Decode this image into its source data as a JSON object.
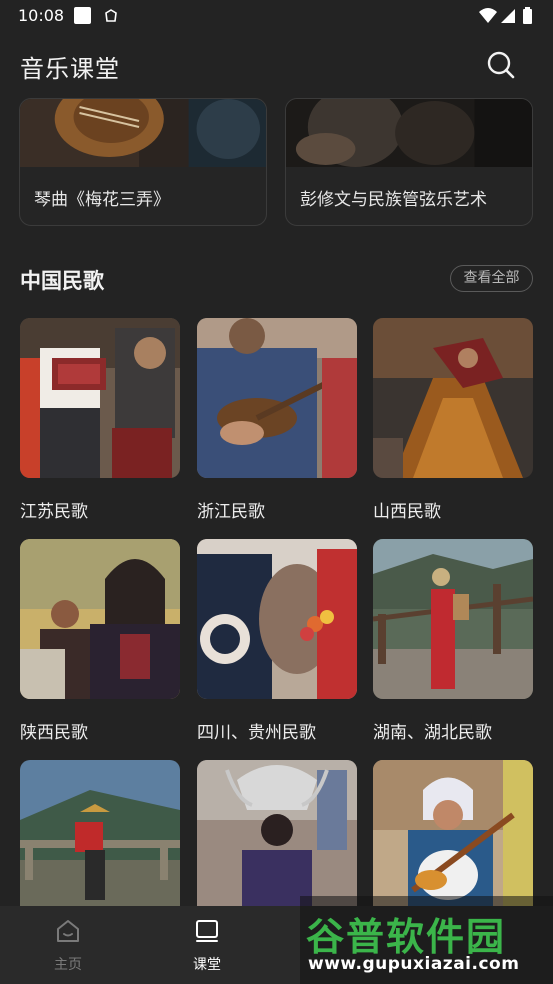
{
  "status_bar": {
    "time": "10:08"
  },
  "app_bar": {
    "title": "音乐课堂"
  },
  "top_cards": [
    {
      "label": "琴曲《梅花三弄》"
    },
    {
      "label": "彭修文与民族管弦乐艺术"
    }
  ],
  "section": {
    "title": "中国民歌",
    "view_all": "查看全部"
  },
  "folk_songs": [
    {
      "label": "江苏民歌"
    },
    {
      "label": "浙江民歌"
    },
    {
      "label": "山西民歌"
    },
    {
      "label": "陕西民歌"
    },
    {
      "label": "四川、贵州民歌"
    },
    {
      "label": "湖南、湖北民歌"
    },
    {
      "label": ""
    },
    {
      "label": ""
    },
    {
      "label": ""
    }
  ],
  "bottom_nav": [
    {
      "label": "主页",
      "icon": "home-icon",
      "active": false
    },
    {
      "label": "课堂",
      "icon": "classroom-icon",
      "active": true
    }
  ],
  "watermark": {
    "main": "谷普软件园",
    "sub": "www.gupuxiazai.com"
  },
  "colors": {
    "background": "#232323",
    "nav_active": "#ffffff",
    "nav_inactive": "#7a7a7a",
    "watermark_green": "#3bb54a"
  }
}
